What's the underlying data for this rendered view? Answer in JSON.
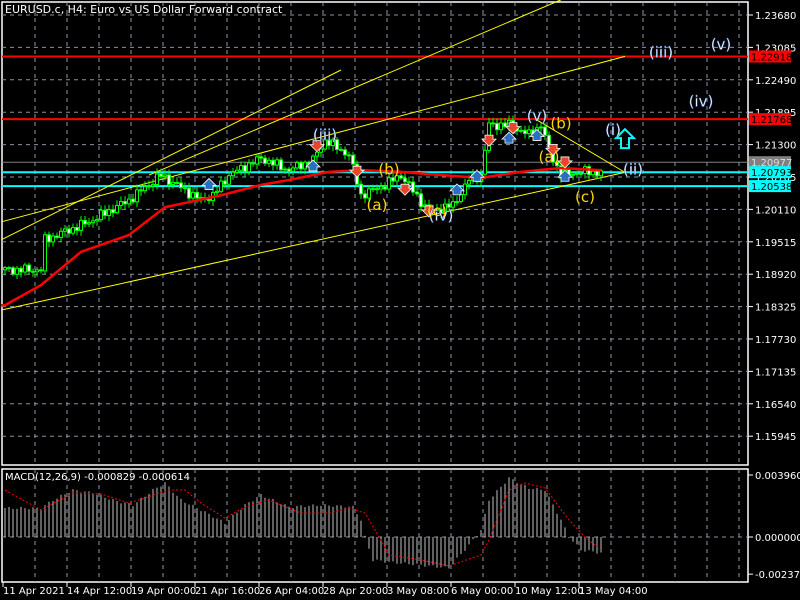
{
  "header": {
    "title": "EURUSD.c, H4:  Euro vs US Dollar Forward contract"
  },
  "macd": {
    "title": "MACD(12,26,9) -0.000829 -0.000614"
  },
  "colors": {
    "candle": "#00ff00",
    "ma": "#ff0000",
    "resistance": "#ff0000",
    "support": "#00ffff",
    "trend": "#ffff00",
    "grid": "#8a93a6",
    "histogram": "#c0c0c0",
    "signal": "#ff0000"
  },
  "price_axis": {
    "ticks": [
      "1.23680",
      "1.23085",
      "1.22490",
      "1.21895",
      "1.21300",
      "1.20705",
      "1.20110",
      "1.19515",
      "1.18920",
      "1.18325",
      "1.17730",
      "1.17135",
      "1.16540",
      "1.15945"
    ],
    "range": [
      1.1535,
      1.242
    ]
  },
  "price_levels": [
    {
      "label": "1.22918",
      "price": 1.22918,
      "kind": "resistance"
    },
    {
      "label": "1.21768",
      "price": 1.21768,
      "kind": "resistance"
    },
    {
      "label": "1.20977",
      "price": 1.20977,
      "kind": "current"
    },
    {
      "label": "1.20793",
      "price": 1.20793,
      "kind": "support"
    },
    {
      "label": "1.20538",
      "price": 1.20538,
      "kind": "support"
    }
  ],
  "macd_axis": {
    "ticks": [
      "0.003960",
      "0.000000",
      "-0.002375"
    ],
    "tick_values": [
      0.00396,
      0,
      -0.002375
    ]
  },
  "time_axis": {
    "labels": [
      "11 Apr 2021",
      "14 Apr 12:00",
      "19 Apr 00:00",
      "21 Apr 16:00",
      "26 Apr 04:00",
      "28 Apr 20:00",
      "3 May 08:00",
      "6 May 00:00",
      "10 May 12:00",
      "13 May 04:00"
    ]
  },
  "wave_labels": [
    {
      "text": "(iii)",
      "bar": 80,
      "price": 1.2138,
      "color": "white"
    },
    {
      "text": "(v)",
      "bar": 133,
      "price": 1.2173,
      "color": "white"
    },
    {
      "text": "(iv)",
      "bar": 109,
      "price": 1.1991,
      "color": "white"
    },
    {
      "text": "(a)",
      "bar": 93,
      "price": 1.201,
      "color": "yellow"
    },
    {
      "text": "(b)",
      "bar": 96,
      "price": 1.2075,
      "color": "yellow"
    },
    {
      "text": "(c)",
      "bar": 108,
      "price": 1.1999,
      "color": "yellow"
    },
    {
      "text": "(b)",
      "bar": 139,
      "price": 1.216,
      "color": "yellow"
    },
    {
      "text": "(a)",
      "bar": 136,
      "price": 1.2098,
      "color": "yellow"
    },
    {
      "text": "(c)",
      "bar": 145,
      "price": 1.2025,
      "color": "yellow"
    },
    {
      "text": "(i)",
      "bar": 152,
      "price": 1.2148,
      "color": "white"
    },
    {
      "text": "(ii)",
      "bar": 157,
      "price": 1.2075,
      "color": "white"
    },
    {
      "text": "(iii)",
      "bar": 164,
      "price": 1.229,
      "color": "white"
    },
    {
      "text": "(iv)",
      "bar": 174,
      "price": 1.22,
      "color": "white"
    },
    {
      "text": "(v)",
      "bar": 179,
      "price": 1.2305,
      "color": "white"
    }
  ],
  "chart_data": {
    "type": "candlestick",
    "symbol": "EURUSD.c",
    "timeframe": "H4",
    "close_waypoints": [
      [
        0,
        1.19
      ],
      [
        9,
        1.19
      ],
      [
        10,
        1.1955
      ],
      [
        21,
        1.1988
      ],
      [
        31,
        1.2028
      ],
      [
        39,
        1.2074
      ],
      [
        49,
        1.2028
      ],
      [
        52,
        1.2037
      ],
      [
        56,
        1.2074
      ],
      [
        64,
        1.2105
      ],
      [
        71,
        1.2083
      ],
      [
        77,
        1.2102
      ],
      [
        80,
        1.2138
      ],
      [
        86,
        1.2111
      ],
      [
        89,
        1.2037
      ],
      [
        95,
        1.2056
      ],
      [
        99,
        1.2074
      ],
      [
        106,
        1.2006
      ],
      [
        112,
        1.2019
      ],
      [
        116,
        1.2065
      ],
      [
        119,
        1.2074
      ],
      [
        121,
        1.2166
      ],
      [
        126,
        1.2166
      ],
      [
        131,
        1.2148
      ],
      [
        134,
        1.2166
      ],
      [
        136,
        1.212
      ],
      [
        139,
        1.2074
      ],
      [
        144,
        1.208
      ],
      [
        149,
        1.2079
      ]
    ],
    "ma_waypoints": [
      [
        0,
        1.1835
      ],
      [
        9,
        1.1872
      ],
      [
        19,
        1.1933
      ],
      [
        31,
        1.1964
      ],
      [
        40,
        1.2015
      ],
      [
        54,
        1.2037
      ],
      [
        64,
        1.2056
      ],
      [
        71,
        1.2065
      ],
      [
        81,
        1.208
      ],
      [
        89,
        1.2083
      ],
      [
        99,
        1.208
      ],
      [
        109,
        1.2074
      ],
      [
        119,
        1.2069
      ],
      [
        129,
        1.208
      ],
      [
        139,
        1.2087
      ],
      [
        149,
        1.2083
      ]
    ],
    "macd_hist_waypoints": [
      [
        0,
        0.00185
      ],
      [
        9,
        0.00185
      ],
      [
        12,
        0.00236
      ],
      [
        17,
        0.003
      ],
      [
        22,
        0.00281
      ],
      [
        27,
        0.00236
      ],
      [
        32,
        0.00204
      ],
      [
        37,
        0.003
      ],
      [
        40,
        0.00345
      ],
      [
        44,
        0.00236
      ],
      [
        49,
        0.00173
      ],
      [
        55,
        0.00089
      ],
      [
        60,
        0.00204
      ],
      [
        64,
        0.00268
      ],
      [
        71,
        0.00192
      ],
      [
        79,
        0.00204
      ],
      [
        87,
        0.00192
      ],
      [
        89,
        0.00109
      ],
      [
        90,
        0
      ],
      [
        92,
        -0.00147
      ],
      [
        96,
        -0.0016
      ],
      [
        104,
        -0.00179
      ],
      [
        111,
        -0.00198
      ],
      [
        116,
        -0.00051
      ],
      [
        119,
        0.00045
      ],
      [
        121,
        0.00236
      ],
      [
        126,
        0.00377
      ],
      [
        131,
        0.00313
      ],
      [
        135,
        0.003
      ],
      [
        139,
        0.00109
      ],
      [
        141,
        0
      ],
      [
        144,
        -0.00083
      ],
      [
        149,
        -0.00102
      ]
    ],
    "macd_signal_waypoints": [
      [
        0,
        0.003
      ],
      [
        9,
        0.00173
      ],
      [
        17,
        0.00281
      ],
      [
        24,
        0.00275
      ],
      [
        31,
        0.00217
      ],
      [
        41,
        0.003
      ],
      [
        45,
        0.003
      ],
      [
        49,
        0.00217
      ],
      [
        55,
        0.00121
      ],
      [
        60,
        0.00192
      ],
      [
        66,
        0.00236
      ],
      [
        74,
        0.00153
      ],
      [
        81,
        0.00153
      ],
      [
        86,
        0.00185
      ],
      [
        90,
        0.00153
      ],
      [
        94,
        -0.00019
      ],
      [
        96,
        -0.00115
      ],
      [
        104,
        -0.00147
      ],
      [
        111,
        -0.00185
      ],
      [
        119,
        -0.00115
      ],
      [
        121,
        -0.00019
      ],
      [
        126,
        0.003
      ],
      [
        130,
        0.00345
      ],
      [
        135,
        0.00313
      ],
      [
        141,
        0.00109
      ],
      [
        145,
        0
      ],
      [
        149,
        -0.00083
      ]
    ],
    "trend_lines": [
      {
        "from": [
          -1,
          1.1955
        ],
        "to": [
          84,
          1.2267
        ]
      },
      {
        "from": [
          36,
          1.2074
        ],
        "to": [
          139,
          1.2396
        ]
      },
      {
        "from": [
          -1,
          1.1988
        ],
        "to": [
          155,
          1.2292
        ]
      },
      {
        "from": [
          133,
          1.2175
        ],
        "to": [
          155,
          1.2079
        ]
      },
      {
        "from": [
          -1,
          1.1826
        ],
        "to": [
          155,
          1.2079
        ]
      }
    ],
    "signals": [
      {
        "bar": 78,
        "price": 1.213,
        "dir": "down"
      },
      {
        "bar": 88,
        "price": 1.2083,
        "dir": "down"
      },
      {
        "bar": 100,
        "price": 1.205,
        "dir": "down"
      },
      {
        "bar": 106,
        "price": 1.201,
        "dir": "down"
      },
      {
        "bar": 121,
        "price": 1.214,
        "dir": "down"
      },
      {
        "bar": 127,
        "price": 1.2163,
        "dir": "down"
      },
      {
        "bar": 137,
        "price": 1.2123,
        "dir": "down"
      },
      {
        "bar": 140,
        "price": 1.21,
        "dir": "down"
      },
      {
        "bar": 51,
        "price": 1.2055,
        "dir": "up"
      },
      {
        "bar": 77,
        "price": 1.2089,
        "dir": "up"
      },
      {
        "bar": 113,
        "price": 1.2045,
        "dir": "up"
      },
      {
        "bar": 118,
        "price": 1.207,
        "dir": "up"
      },
      {
        "bar": 126,
        "price": 1.214,
        "dir": "up"
      },
      {
        "bar": 133,
        "price": 1.2145,
        "dir": "up"
      },
      {
        "bar": 140,
        "price": 1.207,
        "dir": "up"
      }
    ],
    "forecast_arrow": {
      "bar": 155,
      "price": 1.214,
      "dir": "up"
    }
  }
}
